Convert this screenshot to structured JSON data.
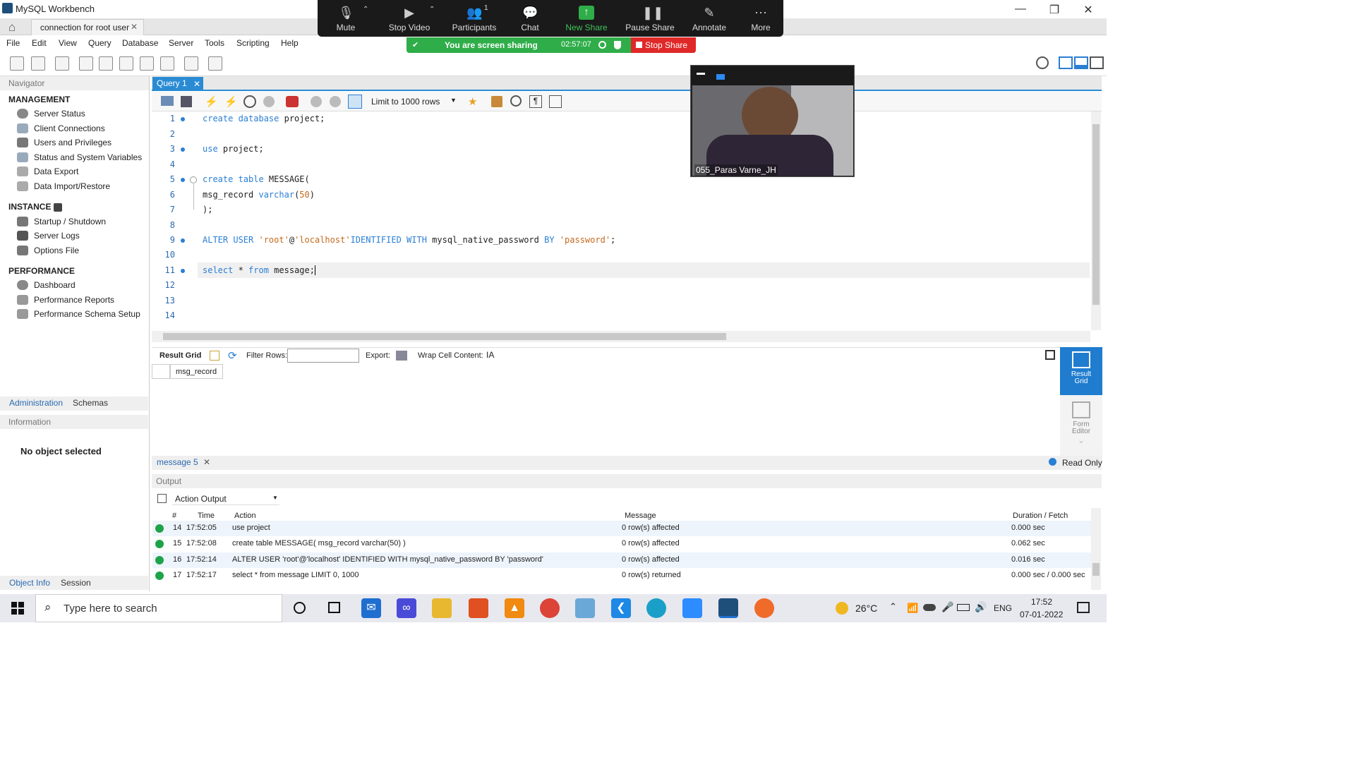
{
  "window": {
    "title": "MySQL Workbench"
  },
  "connection_tab": {
    "label": "connection for root user"
  },
  "menu": [
    "File",
    "Edit",
    "View",
    "Query",
    "Database",
    "Server",
    "Tools",
    "Scripting",
    "Help"
  ],
  "navigator": {
    "title": "Navigator",
    "management_title": "MANAGEMENT",
    "management": [
      "Server Status",
      "Client Connections",
      "Users and Privileges",
      "Status and System Variables",
      "Data Export",
      "Data Import/Restore"
    ],
    "instance_title": "INSTANCE",
    "instance": [
      "Startup / Shutdown",
      "Server Logs",
      "Options File"
    ],
    "performance_title": "PERFORMANCE",
    "performance": [
      "Dashboard",
      "Performance Reports",
      "Performance Schema Setup"
    ],
    "tabs": [
      "Administration",
      "Schemas"
    ],
    "information_title": "Information",
    "no_object": "No object selected",
    "bottom_tabs": [
      "Object Info",
      "Session"
    ]
  },
  "editor": {
    "tab_label": "Query 1",
    "limit_label": "Limit to 1000 rows",
    "line_numbers": [
      "1",
      "2",
      "3",
      "4",
      "5",
      "6",
      "7",
      "8",
      "9",
      "10",
      "11",
      "12",
      "13",
      "14"
    ]
  },
  "result": {
    "grid_label": "Result Grid",
    "filter_label": "Filter Rows:",
    "export_label": "Export:",
    "wrap_label": "Wrap Cell Content:",
    "column": "msg_record",
    "side_result": "Result Grid",
    "side_form": "Form Editor",
    "message_tab": "message 5",
    "read_only": "Read Only"
  },
  "output": {
    "title": "Output",
    "dropdown": "Action Output",
    "headers": [
      "#",
      "Time",
      "Action",
      "Message",
      "Duration / Fetch"
    ],
    "rows": [
      {
        "n": "14",
        "time": "17:52:05",
        "action": "use project",
        "message": "0 row(s) affected",
        "duration": "0.000 sec"
      },
      {
        "n": "15",
        "time": "17:52:08",
        "action": "create table MESSAGE( msg_record varchar(50) )",
        "message": "0 row(s) affected",
        "duration": "0.062 sec"
      },
      {
        "n": "16",
        "time": "17:52:14",
        "action": "ALTER USER 'root'@'localhost' IDENTIFIED WITH mysql_native_password BY 'password'",
        "message": "0 row(s) affected",
        "duration": "0.016 sec"
      },
      {
        "n": "17",
        "time": "17:52:17",
        "action": "select * from message LIMIT 0, 1000",
        "message": "0 row(s) returned",
        "duration": "0.000 sec / 0.000 sec"
      }
    ]
  },
  "zoom": {
    "buttons": [
      "Mute",
      "Stop Video",
      "Participants",
      "Chat",
      "New Share",
      "Pause Share",
      "Annotate",
      "More"
    ],
    "participants_count": "1",
    "sharing_text": "You are screen sharing",
    "timer": "02:57:07",
    "stop_share": "Stop Share",
    "video_name": "055_Paras Varne_JH"
  },
  "taskbar": {
    "search_placeholder": "Type here to search",
    "temperature": "26°C",
    "lang": "ENG",
    "time": "17:52",
    "date": "07-01-2022"
  }
}
